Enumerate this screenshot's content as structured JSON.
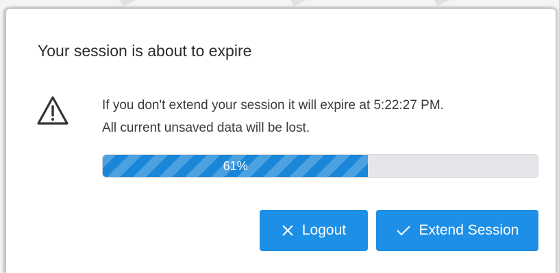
{
  "dialog": {
    "title": "Your session is about to expire",
    "icon": "warning-triangle-icon",
    "message_line1": "If you don't extend your session it will expire at 5:22:27 PM.",
    "message_line2": "All current unsaved data will be lost.",
    "progress": {
      "percent": 61,
      "label": "61%",
      "color": "#1a86d8"
    },
    "buttons": {
      "logout": {
        "label": "Logout",
        "icon": "close-icon"
      },
      "extend": {
        "label": "Extend Session",
        "icon": "check-icon"
      },
      "color": "#1e8fe6"
    }
  }
}
